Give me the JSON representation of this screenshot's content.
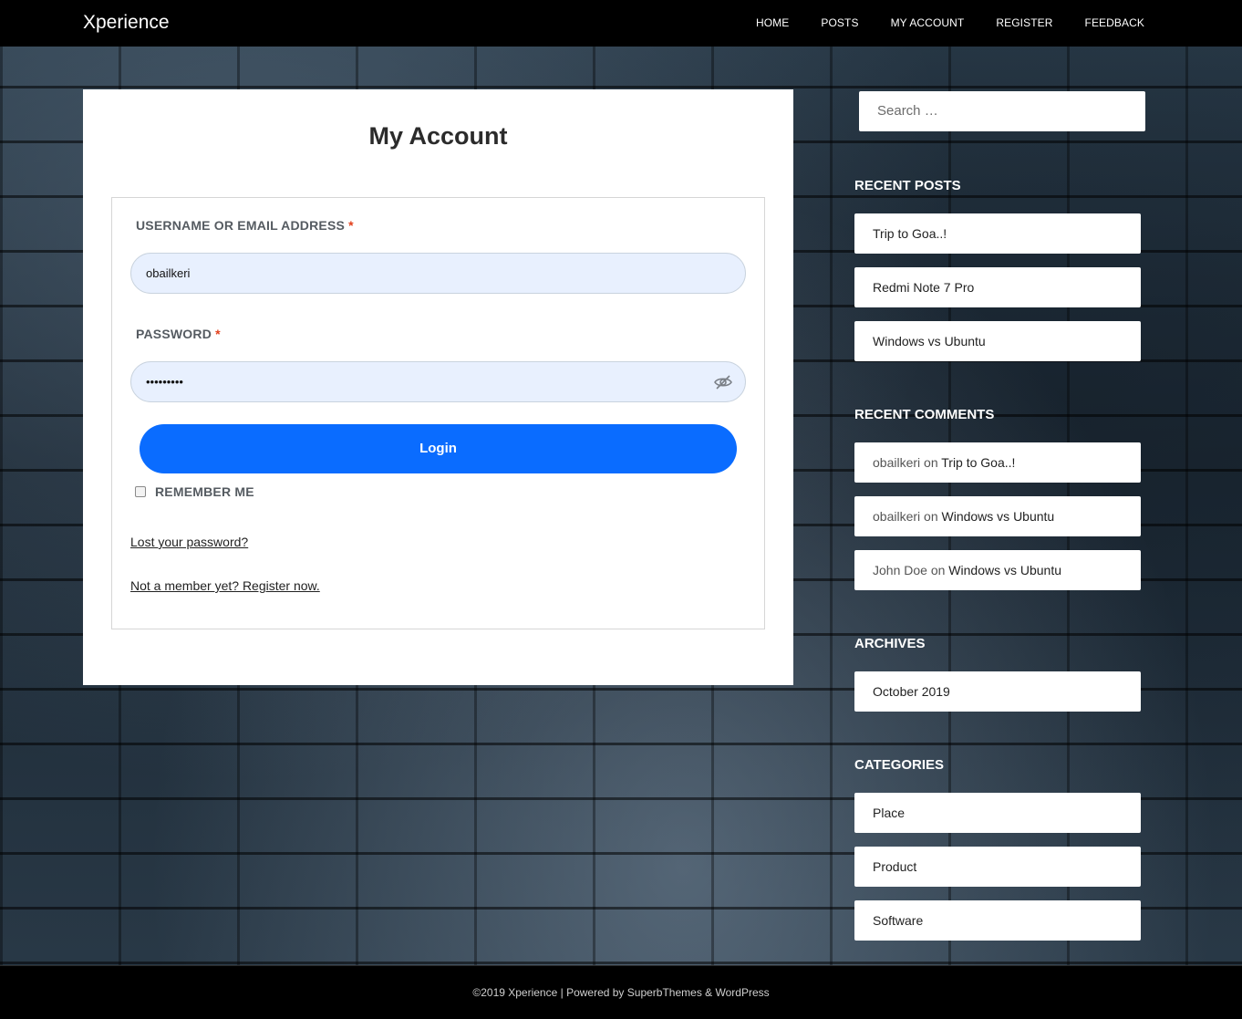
{
  "header": {
    "brand": "Xperience",
    "nav": [
      "HOME",
      "POSTS",
      "MY ACCOUNT",
      "REGISTER",
      "FEEDBACK"
    ]
  },
  "main": {
    "title": "My Account",
    "username_label": "USERNAME OR EMAIL ADDRESS",
    "required_mark": "*",
    "username_value": "obailkeri",
    "password_label": "PASSWORD",
    "password_value": "•••••••••",
    "login_label": "Login",
    "remember_label": "REMEMBER ME",
    "lost_password": "Lost your password?",
    "register_link": "Not a member yet? Register now."
  },
  "sidebar": {
    "search_placeholder": "Search …",
    "recent_posts_title": "RECENT POSTS",
    "recent_posts": [
      "Trip to Goa..!",
      "Redmi Note 7 Pro",
      "Windows vs Ubuntu"
    ],
    "recent_comments_title": "RECENT COMMENTS",
    "recent_comments": [
      {
        "author": "obailkeri",
        "on": "on",
        "post": "Trip to Goa..!"
      },
      {
        "author": "obailkeri",
        "on": "on",
        "post": "Windows vs Ubuntu"
      },
      {
        "author": "John Doe",
        "on": "on",
        "post": "Windows vs Ubuntu"
      }
    ],
    "archives_title": "ARCHIVES",
    "archives": [
      "October 2019"
    ],
    "categories_title": "CATEGORIES",
    "categories": [
      "Place",
      "Product",
      "Software"
    ]
  },
  "footer": {
    "text": "©2019 Xperience | Powered by SuperbThemes & WordPress"
  },
  "colors": {
    "accent": "#0a6cff",
    "required": "#e2401c",
    "field_bg": "#e8f0fe"
  }
}
